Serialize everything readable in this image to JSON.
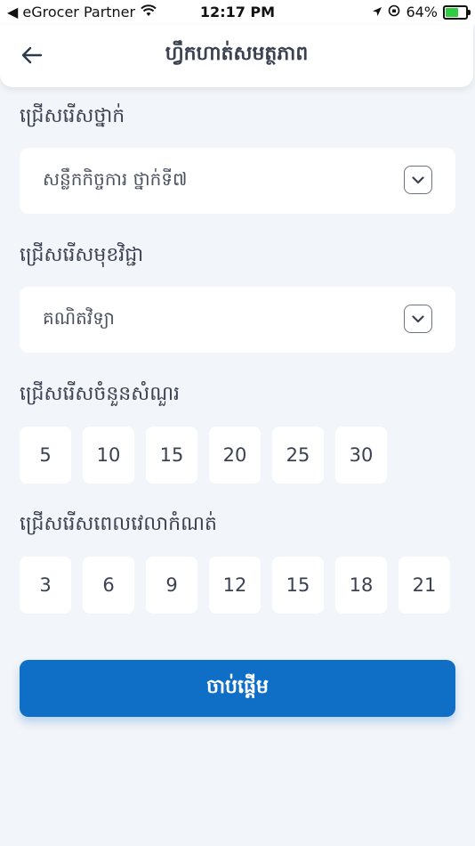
{
  "status_bar": {
    "back_label": "◀ eGrocer Partner",
    "time": "12:17 PM",
    "battery_percent": "64%",
    "battery_level": 0.64
  },
  "header": {
    "title": "ហ្វឹកហាត់សមត្ថភាព",
    "back_icon": "arrow-left-icon"
  },
  "grade": {
    "label": "ជ្រើសរើសថ្នាក់",
    "selected": "សន្លឹកកិច្ចការ ថ្នាក់ទី៧"
  },
  "subject": {
    "label": "ជ្រើសរើសមុខវិជ្ជា",
    "selected": "គណិតវិទ្យា"
  },
  "questions": {
    "label": "ជ្រើសរើសចំនួនសំណួរ",
    "options": [
      "5",
      "10",
      "15",
      "20",
      "25",
      "30"
    ]
  },
  "time_limit": {
    "label": "ជ្រើសរើសពេលវេលាកំណត់",
    "options": [
      "3",
      "6",
      "9",
      "12",
      "15",
      "18",
      "21"
    ]
  },
  "start_button": {
    "label": "ចាប់ផ្ដើម",
    "color": "#0f6fc6"
  }
}
